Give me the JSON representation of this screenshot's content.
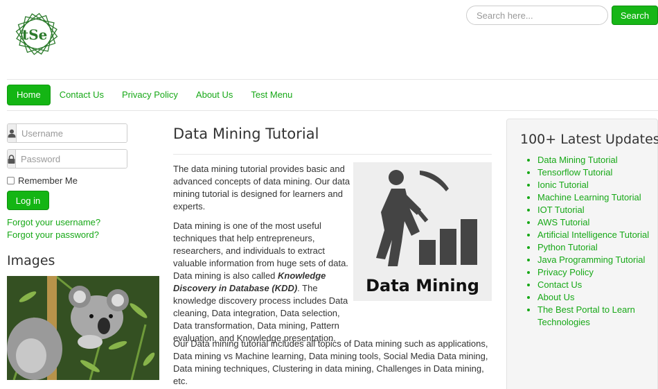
{
  "header": {
    "logo_text": "tSe",
    "search_placeholder": "Search here...",
    "search_button": "Search"
  },
  "nav": [
    {
      "label": "Home",
      "active": true
    },
    {
      "label": "Contact Us"
    },
    {
      "label": "Privacy Policy"
    },
    {
      "label": "About Us"
    },
    {
      "label": "Test Menu"
    }
  ],
  "login": {
    "username_placeholder": "Username",
    "password_placeholder": "Password",
    "remember_label": "Remember Me",
    "login_button": "Log in",
    "forgot_username": "Forgot your username?",
    "forgot_password": "Forgot your password?"
  },
  "images_heading": "Images",
  "article": {
    "title": "Data Mining Tutorial",
    "image_caption": "Data Mining",
    "p1": "The data mining tutorial provides basic and advanced concepts of data mining. Our data mining tutorial is designed for learners and experts.",
    "p2_a": "Data mining is one of the most useful techniques that help entrepreneurs, researchers, and individuals to extract valuable information from huge sets of data. Data mining is also called ",
    "p2_em": "Knowledge Discovery in Database (KDD)",
    "p2_b": ". The knowledge discovery process includes Data cleaning, Data integration, Data selection, Data transformation, Data mining, Pattern evaluation, and Knowledge presentation.",
    "p3": "Our Data mining tutorial includes all topics of Data mining such as applications, Data mining vs Machine learning, Data mining tools, Social Media Data mining, Data mining techniques, Clustering in data mining, Challenges in Data mining, etc."
  },
  "sidebar": {
    "heading": "100+ Latest Updates",
    "items": [
      "Data Mining Tutorial",
      "Tensorflow Tutorial",
      "Ionic Tutorial",
      "Machine Learning Tutorial",
      "IOT Tutorial",
      "AWS Tutorial",
      "Artificial Intelligence Tutorial",
      "Python Tutorial",
      "Java Programming Tutorial",
      "Privacy Policy",
      "Contact Us",
      "About Us",
      "The Best Portal to Learn Technologies"
    ]
  },
  "colors": {
    "accent": "#14b514",
    "link": "#17a817",
    "icon_gray": "#555555"
  }
}
